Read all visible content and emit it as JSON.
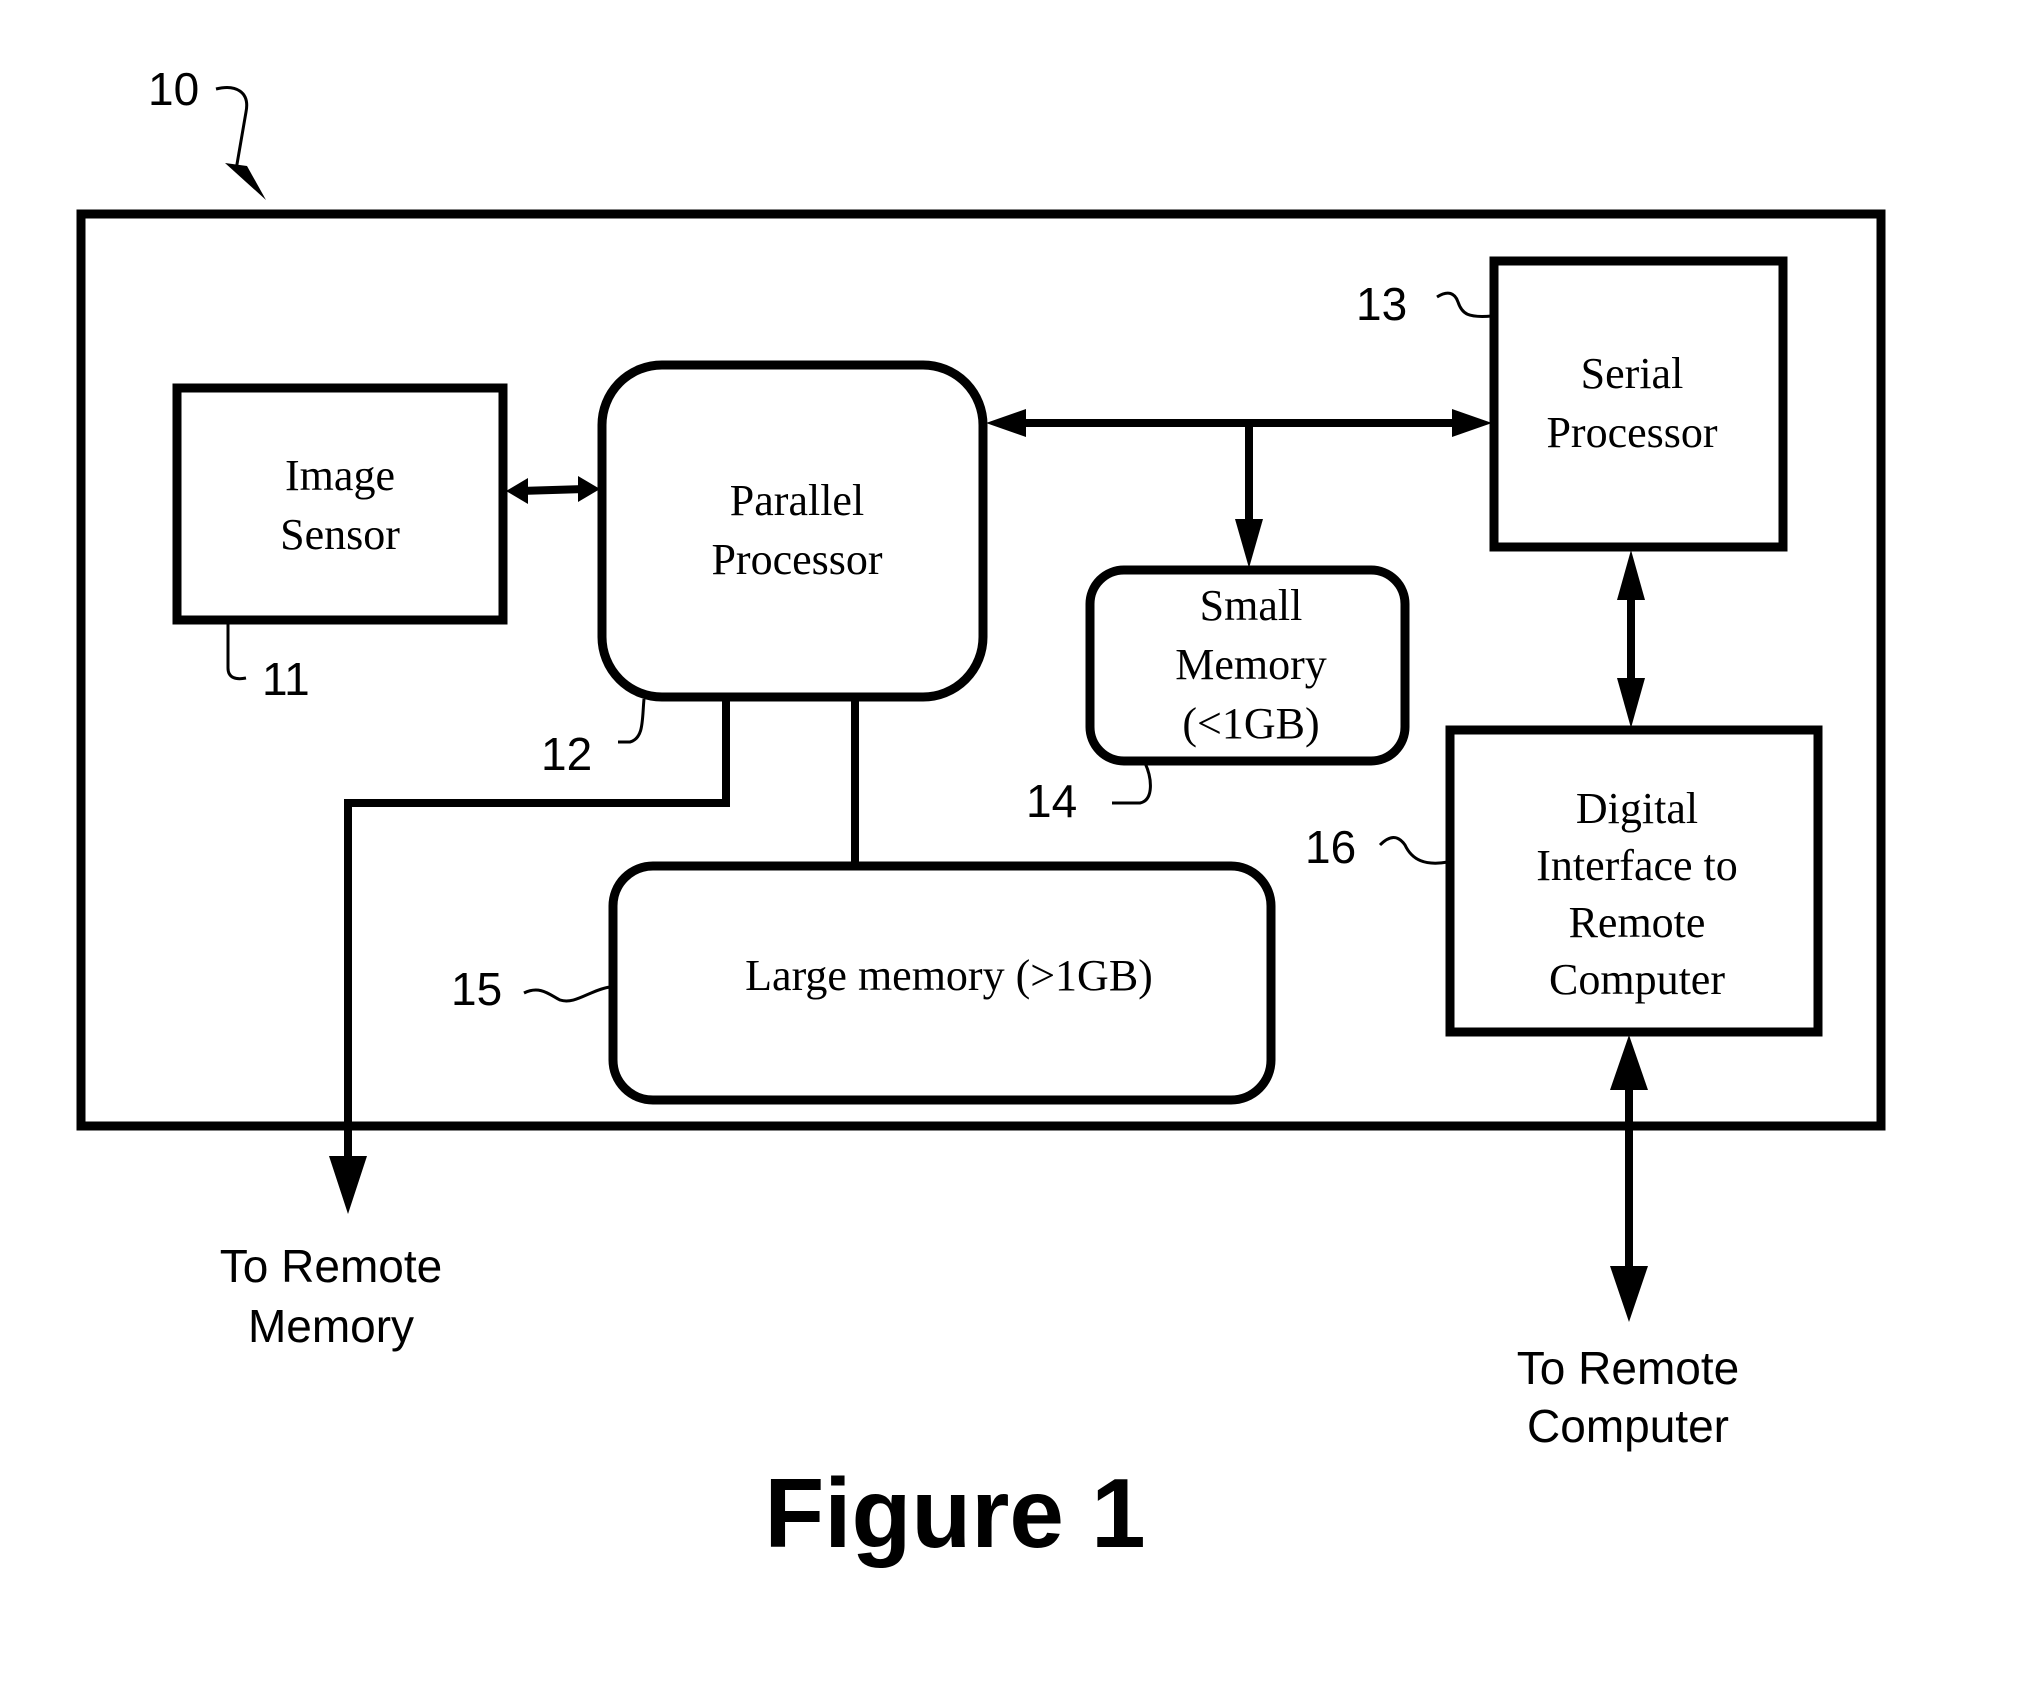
{
  "figure": {
    "caption": "Figure 1",
    "system_ref": "10"
  },
  "blocks": {
    "image_sensor": {
      "ref": "11",
      "lines": [
        "Image",
        "Sensor"
      ]
    },
    "parallel_processor": {
      "ref": "12",
      "lines": [
        "Parallel",
        "Processor"
      ]
    },
    "serial_processor": {
      "ref": "13",
      "lines": [
        "Serial",
        "Processor"
      ]
    },
    "small_memory": {
      "ref": "14",
      "lines": [
        "Small",
        "Memory",
        "(<1GB)"
      ]
    },
    "large_memory": {
      "ref": "15",
      "lines": [
        "Large memory (>1GB)"
      ]
    },
    "digital_interface": {
      "ref": "16",
      "lines": [
        "Digital",
        "Interface to",
        "Remote",
        "Computer"
      ]
    }
  },
  "external": {
    "remote_memory": {
      "lines": [
        "To Remote",
        "Memory"
      ]
    },
    "remote_computer": {
      "lines": [
        "To Remote",
        "Computer"
      ]
    }
  },
  "connections": [
    {
      "from": "image_sensor",
      "to": "parallel_processor",
      "type": "bidirectional"
    },
    {
      "from": "parallel_processor",
      "to": "serial_processor",
      "type": "bidirectional"
    },
    {
      "from": "bus",
      "to": "small_memory",
      "type": "unidirectional"
    },
    {
      "from": "parallel_processor",
      "to": "large_memory",
      "type": "line"
    },
    {
      "from": "parallel_processor",
      "to": "remote_memory",
      "type": "unidirectional"
    },
    {
      "from": "serial_processor",
      "to": "digital_interface",
      "type": "bidirectional"
    },
    {
      "from": "digital_interface",
      "to": "remote_computer",
      "type": "bidirectional"
    }
  ]
}
